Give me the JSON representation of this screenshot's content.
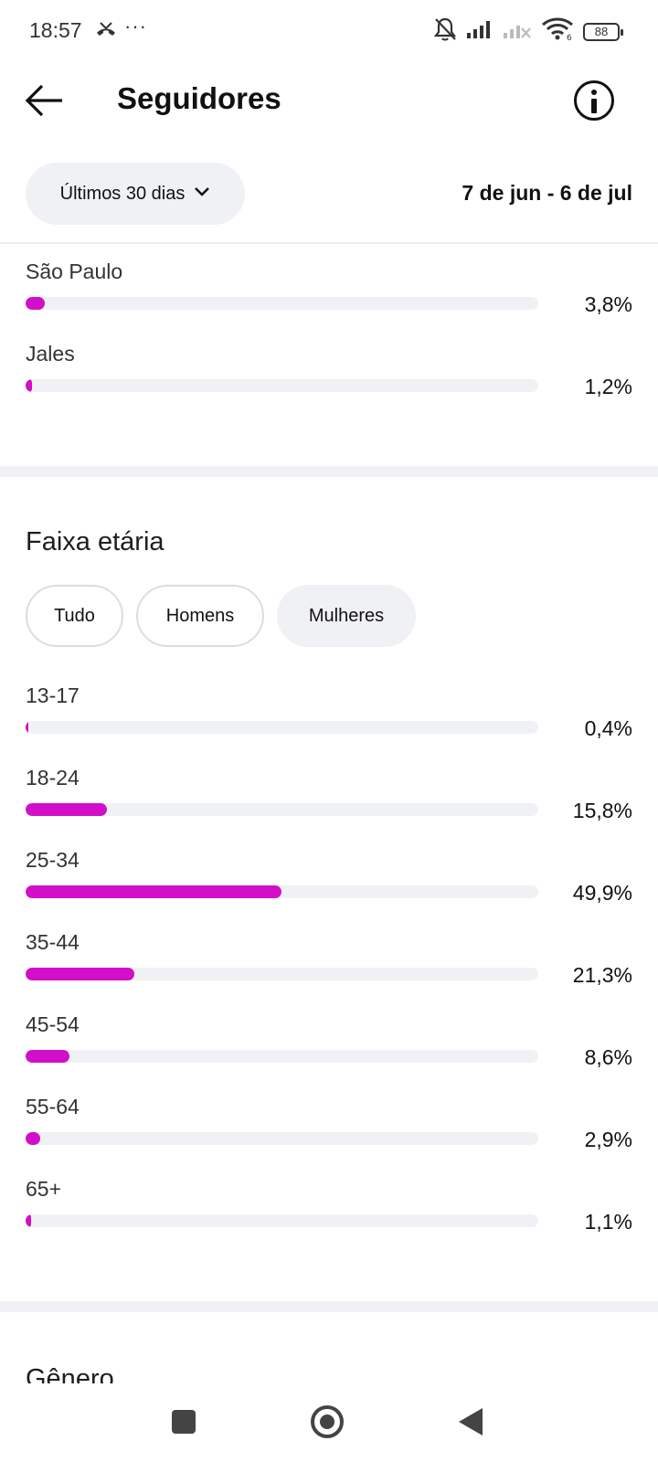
{
  "status_bar": {
    "time": "18:57",
    "dots": "···",
    "battery": "88",
    "wifi_sub": "6"
  },
  "header": {
    "title": "Seguidores"
  },
  "filter": {
    "range_label": "Últimos 30 dias",
    "date_range": "7 de jun - 6 de jul"
  },
  "cities": [
    {
      "name": "São Paulo",
      "value": "3,8%",
      "fill_percent": 3.8
    },
    {
      "name": "Jales",
      "value": "1,2%",
      "fill_percent": 1.2
    }
  ],
  "age_section": {
    "title": "Faixa etária",
    "chips": [
      "Tudo",
      "Homens",
      "Mulheres"
    ],
    "selected_chip": "Mulheres",
    "rows": [
      {
        "label": "13-17",
        "value": "0,4%",
        "fill_percent": 0.4
      },
      {
        "label": "18-24",
        "value": "15,8%",
        "fill_percent": 15.8
      },
      {
        "label": "25-34",
        "value": "49,9%",
        "fill_percent": 49.9
      },
      {
        "label": "35-44",
        "value": "21,3%",
        "fill_percent": 21.3
      },
      {
        "label": "45-54",
        "value": "8,6%",
        "fill_percent": 8.6
      },
      {
        "label": "55-64",
        "value": "2,9%",
        "fill_percent": 2.9
      },
      {
        "label": "65+",
        "value": "1,1%",
        "fill_percent": 1.1
      }
    ]
  },
  "gender_section": {
    "title": "Gênero"
  },
  "colors": {
    "bar_fill": "#d10fc8",
    "bar_track": "#f0f1f5",
    "chip_selected": "#f0f1f4"
  }
}
